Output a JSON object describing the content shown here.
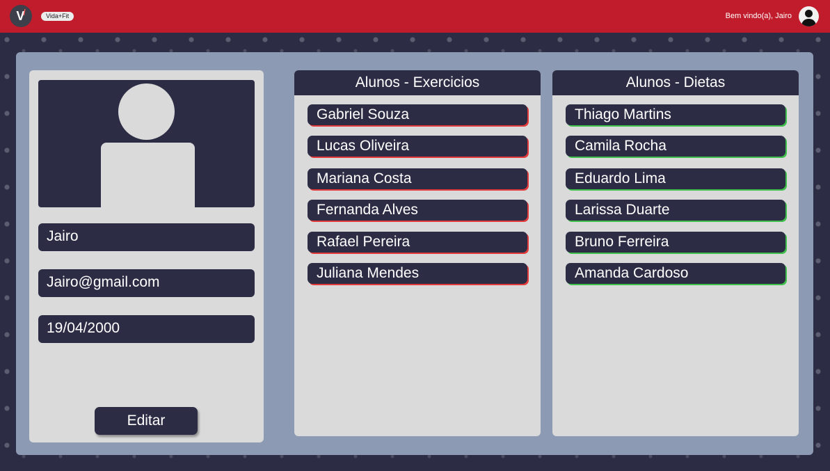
{
  "header": {
    "logo_text": "V",
    "brand": "Vida+Fit",
    "welcome": "Bem vindo(a), Jairo"
  },
  "profile": {
    "name": "Jairo",
    "email": "Jairo@gmail.com",
    "birthdate": "19/04/2000",
    "edit_label": "Editar"
  },
  "exercises": {
    "title": "Alunos - Exercicios",
    "items": [
      "Gabriel Souza",
      "Lucas Oliveira",
      "Mariana Costa",
      "Fernanda Alves",
      "Rafael Pereira",
      "Juliana Mendes"
    ]
  },
  "diets": {
    "title": "Alunos - Dietas",
    "items": [
      "Thiago Martins",
      "Camila Rocha",
      "Eduardo Lima",
      "Larissa Duarte",
      "Bruno Ferreira",
      "Amanda Cardoso"
    ]
  },
  "colors": {
    "header": "#c01c2c",
    "dark": "#2c2d45",
    "exercise_accent": "#e23a3a",
    "diet_accent": "#3ec04a"
  }
}
